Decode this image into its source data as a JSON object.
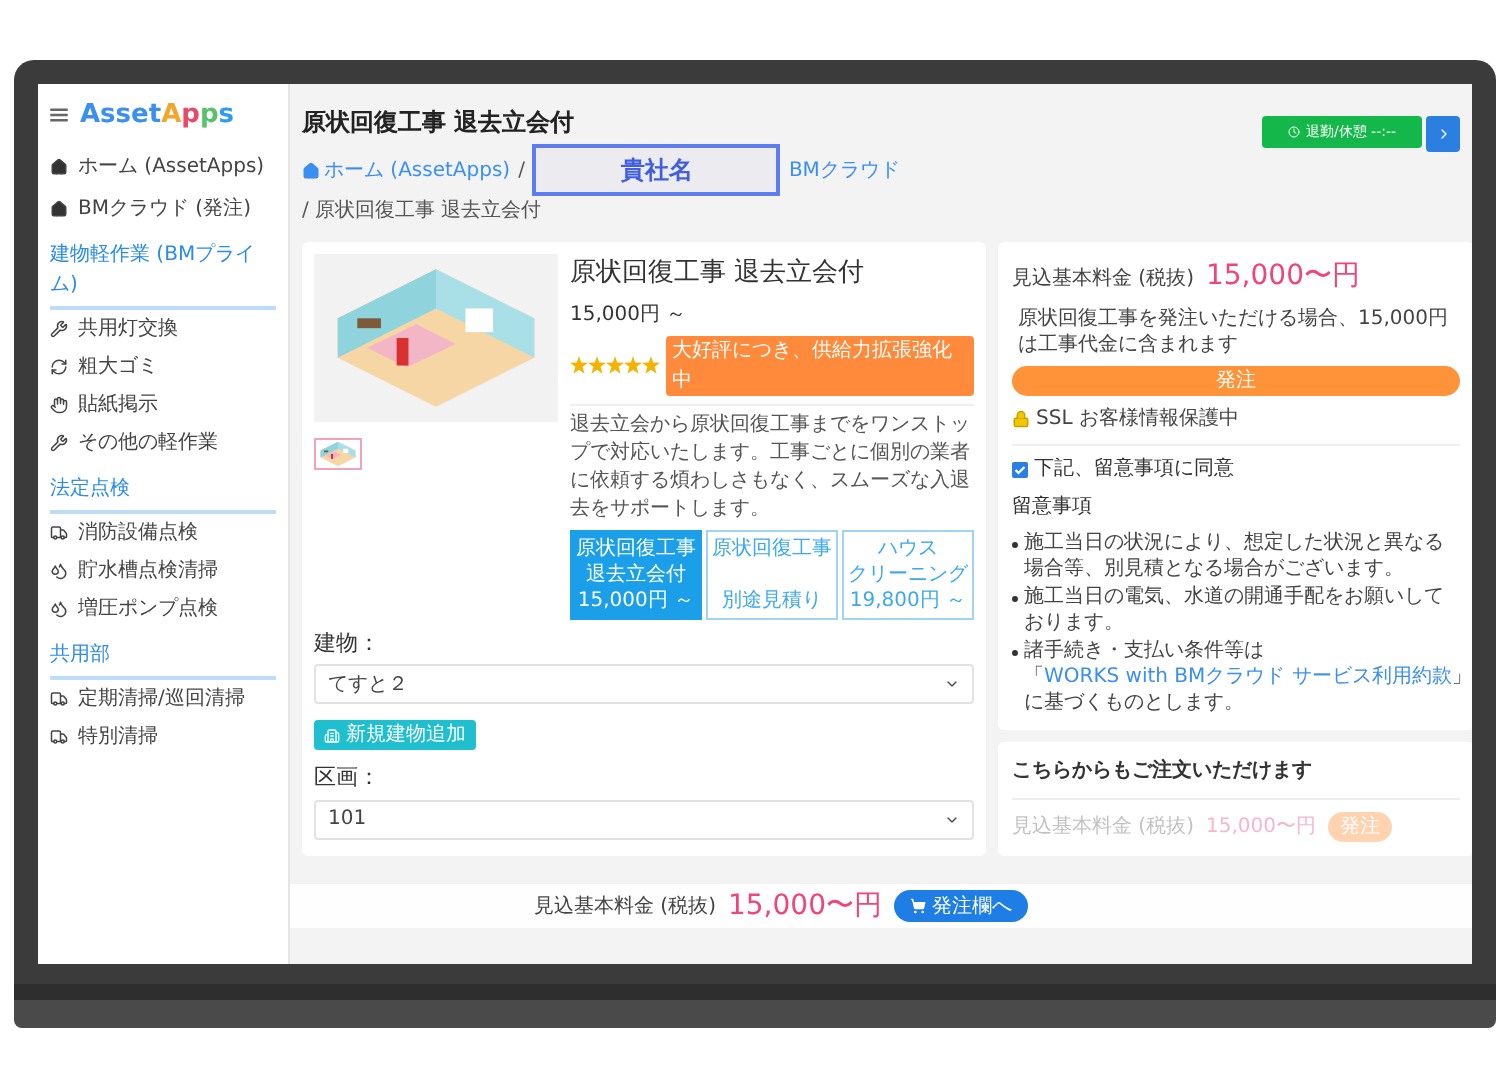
{
  "sidebar": {
    "logo": {
      "part_1": "Asset",
      "part_2": "Apps"
    },
    "top_items": [
      {
        "label": "ホーム (AssetApps)"
      },
      {
        "label": "BMクラウド (発注)"
      }
    ],
    "sections": [
      {
        "title": "建物軽作業 (BMプライム)",
        "items": [
          {
            "label": "共用灯交換"
          },
          {
            "label": "粗大ゴミ"
          },
          {
            "label": "貼紙掲示"
          },
          {
            "label": "その他の軽作業"
          }
        ]
      },
      {
        "title": "法定点検",
        "items": [
          {
            "label": "消防設備点検"
          },
          {
            "label": "貯水槽点検清掃"
          },
          {
            "label": "増圧ポンプ点検"
          }
        ]
      },
      {
        "title": "共用部",
        "items": [
          {
            "label": "定期清掃/巡回清掃"
          },
          {
            "label": "特別清掃"
          }
        ]
      }
    ]
  },
  "header": {
    "title": "原状回復工事 退去立会付",
    "status_button": "退勤/休憩 --:--"
  },
  "breadcrumb": [
    {
      "label": "ホーム (AssetApps)",
      "separator": "/"
    },
    {
      "label": "BMクラウド"
    },
    {
      "label": "原状回復工事 退去立会付",
      "separator": "/"
    }
  ],
  "overlay_label": "貴社名",
  "product": {
    "title": "原状回復工事 退去立会付",
    "price": "15,000円 ～",
    "stars": 5,
    "badge": "大好評につき、供給力拡張強化中",
    "description": "退去立会から原状回復工事までをワンストップで対応いたします。工事ごとに個別の業者に依頼する煩わしさもなく、スムーズな入退去をサポートします。",
    "options": [
      {
        "lines": [
          "原状回復工事",
          "退去立会付",
          "15,000円 ～"
        ],
        "selected": true
      },
      {
        "lines": [
          "原状回復工事",
          "別途見積り"
        ],
        "selected": false
      },
      {
        "lines": [
          "ハウス",
          "クリーニング",
          "19,800円 ～"
        ],
        "selected": false
      }
    ]
  },
  "form": {
    "building_label": "建物：",
    "building_value": "てすと２",
    "add_button": "新規建物追加",
    "unit_label": "区画：",
    "unit_value": "101"
  },
  "order_card": {
    "price_label": "見込基本料金 (税抜)",
    "price": "15,000〜円",
    "note": "原状回復工事を発注いただける場合、15,000円は工事代金に含まれます",
    "order_button": "発注",
    "ssl": "SSL お客様情報保護中",
    "agree": {
      "label": "下記、留意事項に同意",
      "checked": true
    },
    "notes_title": "留意事項",
    "notes": [
      {
        "text": "施工当日の状況により、想定した状況と異なる場合等、別見積となる場合がございます。"
      },
      {
        "text": "施工当日の電気、水道の開通手配をお願いしております。"
      },
      {
        "text": "諸手続き・支払い条件等は「",
        "link": "WORKS with BMクラウド サービス利用約款",
        "after": "」に基づくものとします。"
      }
    ]
  },
  "other_card": {
    "title": "こちらからもご注文いただけます",
    "price_label": "見込基本料金 (税抜)",
    "price": "15,000〜円",
    "button": "発注"
  },
  "bottom_bar": {
    "price_label": "見込基本料金 (税抜)",
    "price": "15,000〜円",
    "button": "発注欄へ"
  }
}
